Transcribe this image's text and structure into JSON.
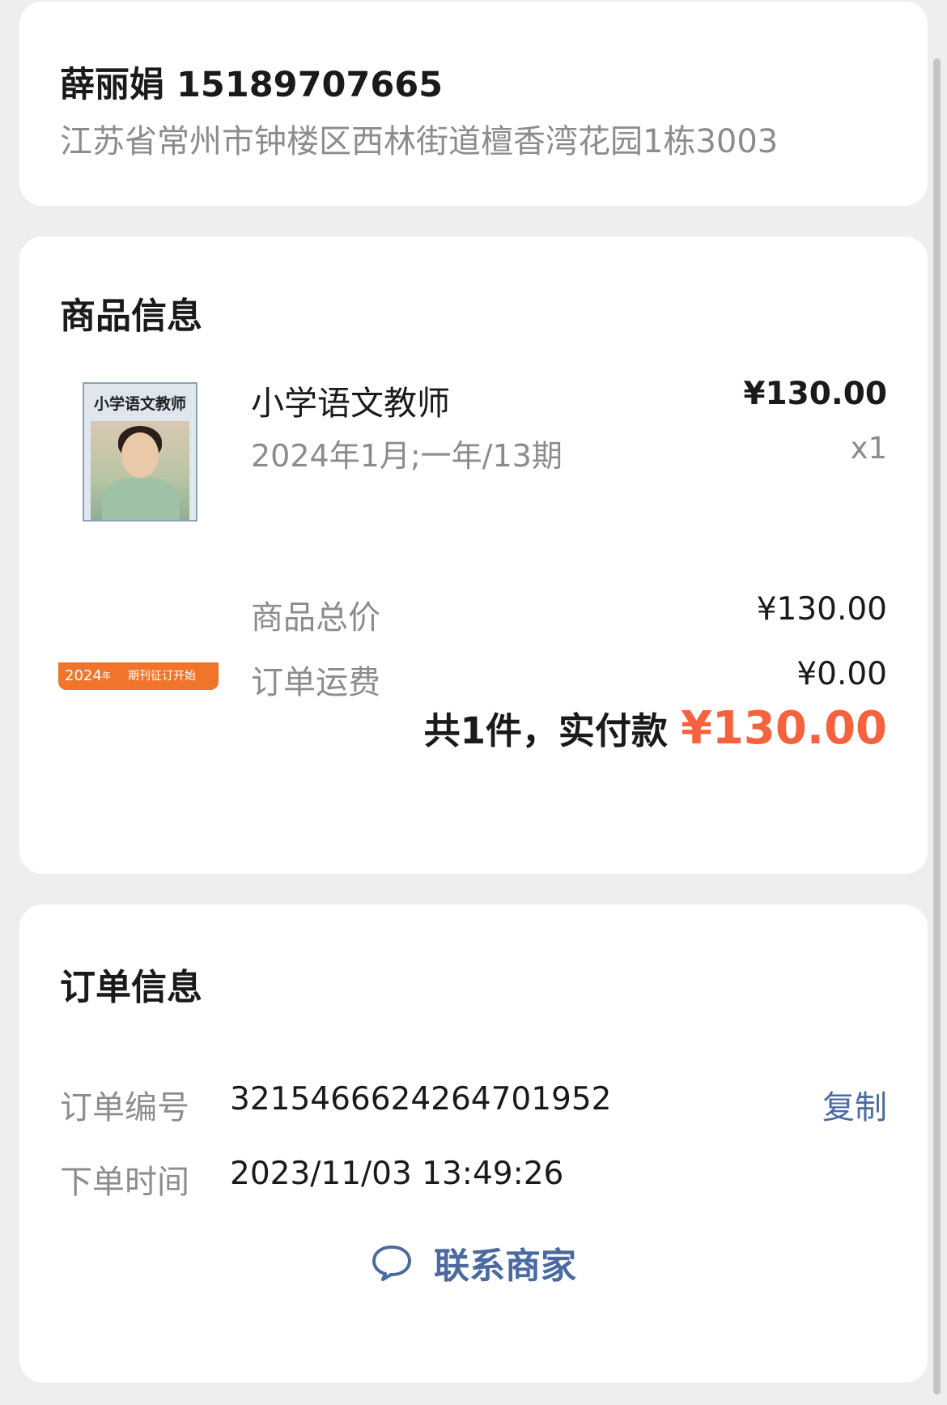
{
  "address": {
    "name": "薛丽娟",
    "phone": "15189707665",
    "full_address": "江苏省常州市钟楼区西林街道檀香湾花园1栋3003"
  },
  "goods": {
    "section_title": "商品信息",
    "item": {
      "cover_title": "小学语文教师",
      "cover_band_year": "2024",
      "cover_band_year_suffix": "年",
      "cover_band_text": "期刊征订开始",
      "title": "小学语文教师",
      "spec": "2024年1月;一年/13期",
      "price": "¥130.00",
      "quantity": "x1"
    },
    "summary": [
      {
        "label": "商品总价",
        "value": "¥130.00"
      },
      {
        "label": "订单运费",
        "value": "¥0.00"
      }
    ],
    "total_text": "共1件，实付款",
    "total_amount": "¥130.00"
  },
  "order": {
    "section_title": "订单信息",
    "number_label": "订单编号",
    "number_value": "3215466624264701952",
    "copy_label": "复制",
    "time_label": "下单时间",
    "time_value": "2023/11/03 13:49:26",
    "contact_label": "联系商家"
  },
  "colors": {
    "accent_price": "#f5623d",
    "link": "#4a6aa0",
    "muted": "#8c8c8c"
  },
  "icons": {
    "contact": "chat-bubble-icon"
  }
}
